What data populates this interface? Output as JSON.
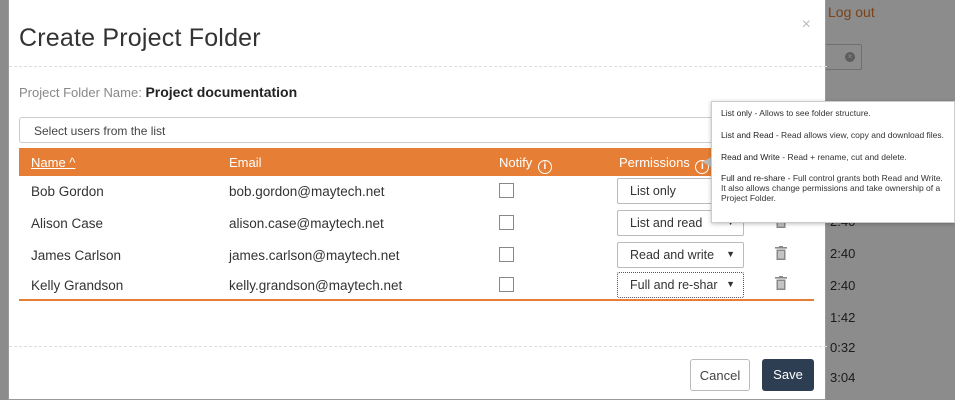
{
  "background": {
    "logout_label": "Log out",
    "times": [
      "2:40",
      "2:40",
      "2:40",
      "1:42",
      "0:32",
      "3:04"
    ]
  },
  "modal": {
    "title": "Create Project Folder",
    "close_label": "×",
    "folder_label": "Project Folder Name:",
    "folder_name": "Project documentation",
    "user_select_placeholder": "Select users from the list",
    "columns": {
      "name": "Name ^",
      "email": "Email",
      "notify": "Notify",
      "permissions": "Permissions"
    },
    "info_glyph": "i",
    "users": [
      {
        "name": "Bob Gordon",
        "email": "bob.gordon@maytech.net",
        "permission": "List only"
      },
      {
        "name": "Alison Case",
        "email": "alison.case@maytech.net",
        "permission": "List and read"
      },
      {
        "name": "James Carlson",
        "email": "james.carlson@maytech.net",
        "permission": "Read and write"
      },
      {
        "name": "Kelly Grandson",
        "email": "kelly.grandson@maytech.net",
        "permission": "Full and re-shar"
      }
    ],
    "buttons": {
      "cancel": "Cancel",
      "save": "Save"
    }
  },
  "tooltip": {
    "items": [
      {
        "term": "List only",
        "desc": " - Allows to see folder structure."
      },
      {
        "term": "List and Read",
        "desc": " - Read allows view, copy and download files."
      },
      {
        "term": "Read and Write",
        "desc": " - Read + rename, cut and delete."
      },
      {
        "term": "Full and re-share",
        "desc": " - Full control grants both Read and Write. It also allows change permissions and take ownership of a Project Folder."
      }
    ]
  },
  "colors": {
    "accent": "#e67f35",
    "save_button": "#2e3e52"
  }
}
